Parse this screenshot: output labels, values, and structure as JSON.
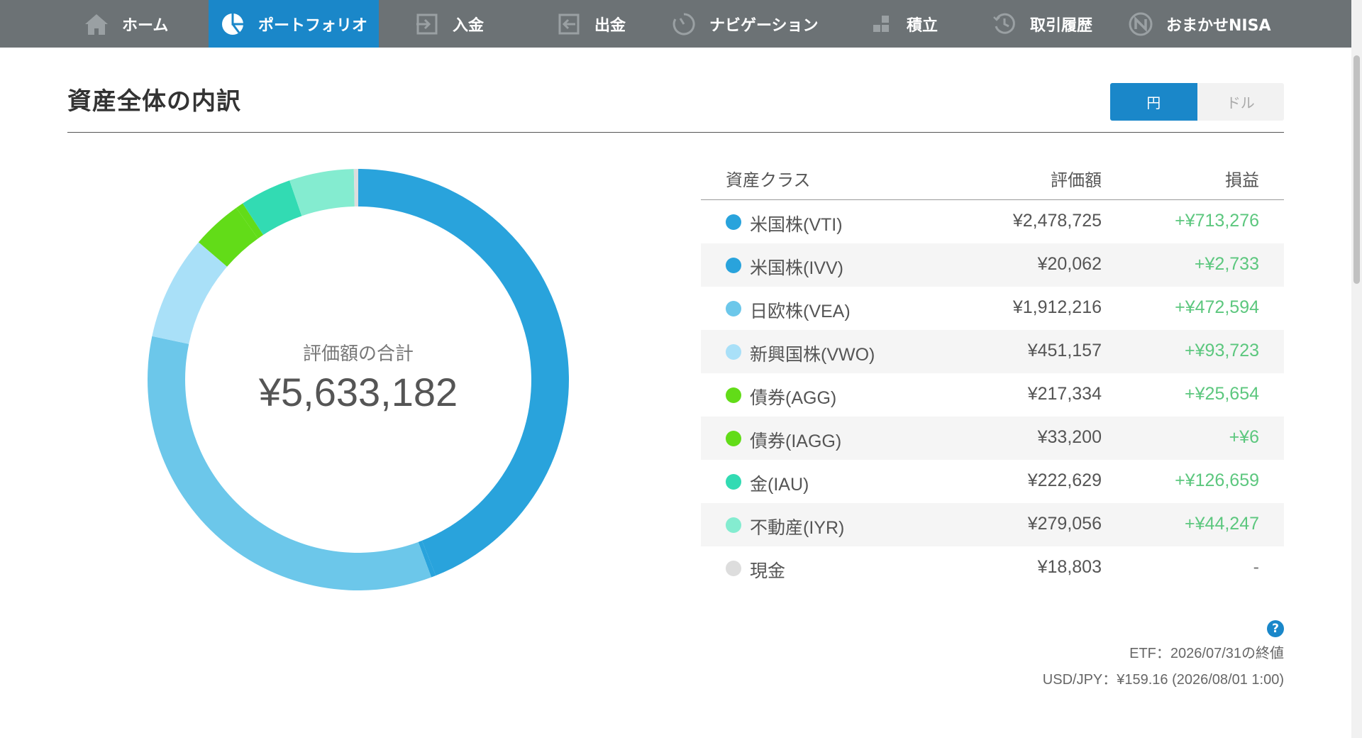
{
  "nav": {
    "items": [
      {
        "label": "ホーム",
        "icon": "home-icon",
        "active": false
      },
      {
        "label": "ポートフォリオ",
        "icon": "pie-chart-icon",
        "active": true
      },
      {
        "label": "入金",
        "icon": "deposit-icon",
        "active": false
      },
      {
        "label": "出金",
        "icon": "withdraw-icon",
        "active": false
      },
      {
        "label": "ナビゲーション",
        "icon": "navigation-dial-icon",
        "active": false
      },
      {
        "label": "積立",
        "icon": "accumulate-blocks-icon",
        "active": false
      },
      {
        "label": "取引履歴",
        "icon": "history-clock-icon",
        "active": false
      },
      {
        "label": "おまかせNISA",
        "icon": "nisa-logo-icon",
        "active": false
      }
    ]
  },
  "section": {
    "title": "資産全体の内訳",
    "currency_toggle": {
      "yen_label": "円",
      "dollar_label": "ドル",
      "selected": "円"
    }
  },
  "donut": {
    "center_label": "評価額の合計",
    "total": "¥5,633,182"
  },
  "table": {
    "headers": {
      "asset_class": "資産クラス",
      "value": "評価額",
      "pl": "損益"
    },
    "rows": [
      {
        "name": "米国株(VTI)",
        "value": "¥2,478,725",
        "pl": "+¥713,276",
        "color": "#29a3dc"
      },
      {
        "name": "米国株(IVV)",
        "value": "¥20,062",
        "pl": "+¥2,733",
        "color": "#29a3dc"
      },
      {
        "name": "日欧株(VEA)",
        "value": "¥1,912,216",
        "pl": "+¥472,594",
        "color": "#6cc7ea"
      },
      {
        "name": "新興国株(VWO)",
        "value": "¥451,157",
        "pl": "+¥93,723",
        "color": "#a9e0f8"
      },
      {
        "name": "債券(AGG)",
        "value": "¥217,334",
        "pl": "+¥25,654",
        "color": "#62dc18"
      },
      {
        "name": "債券(IAGG)",
        "value": "¥33,200",
        "pl": "+¥6",
        "color": "#62dc18"
      },
      {
        "name": "金(IAU)",
        "value": "¥222,629",
        "pl": "+¥126,659",
        "color": "#32dbb3"
      },
      {
        "name": "不動産(IYR)",
        "value": "¥279,056",
        "pl": "+¥44,247",
        "color": "#84ecd0"
      },
      {
        "name": "現金",
        "value": "¥18,803",
        "pl": "-",
        "color": "#dddddd"
      }
    ]
  },
  "chart_data": {
    "type": "pie",
    "categories": [
      "米国株(VTI)",
      "米国株(IVV)",
      "日欧株(VEA)",
      "新興国株(VWO)",
      "債券(AGG)",
      "債券(IAGG)",
      "金(IAU)",
      "不動産(IYR)",
      "現金"
    ],
    "values": [
      2478725,
      20062,
      1912216,
      451157,
      217334,
      33200,
      222629,
      279056,
      18803
    ],
    "colors": [
      "#29a3dc",
      "#29a3dc",
      "#6cc7ea",
      "#a9e0f8",
      "#62dc18",
      "#62dc18",
      "#32dbb3",
      "#84ecd0",
      "#dddddd"
    ]
  },
  "notes": {
    "help": "?",
    "etf": "ETF：2026/07/31の終値",
    "fx": "USD/JPY：¥159.16 (2026/08/01 1:00)"
  },
  "colors": {
    "nav_bg": "#6c7275",
    "accent": "#1a87c9",
    "profit": "#5cc77e"
  }
}
